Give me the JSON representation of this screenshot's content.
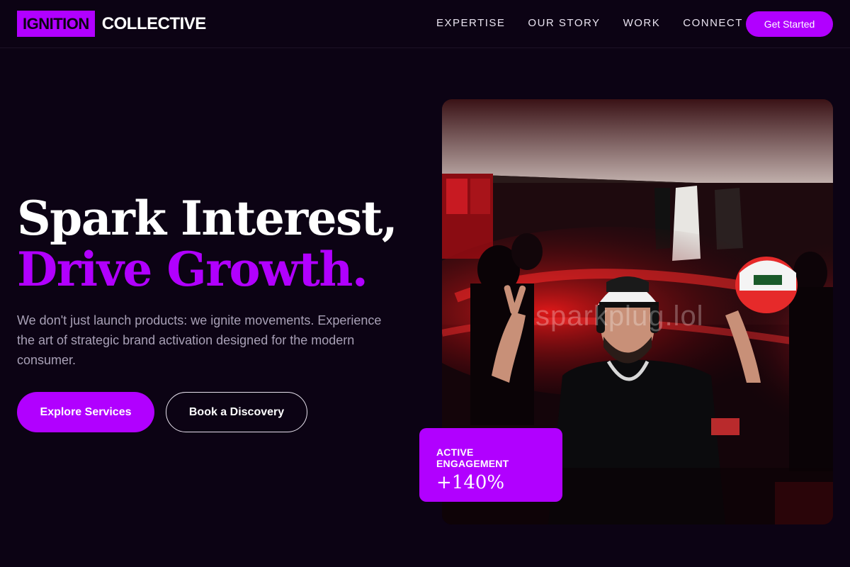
{
  "brand": {
    "logo_box": "IGNITION",
    "logo_text": "COLLECTIVE"
  },
  "nav": {
    "links": [
      "EXPERTISE",
      "OUR STORY",
      "WORK",
      "CONNECT"
    ],
    "cta": "Get Started"
  },
  "hero": {
    "headline_line1": "Spark Interest,",
    "headline_line2": "Drive Growth.",
    "subtext": "We don't just launch products: we ignite movements. Experience the art of strategic brand activation designed for the modern consumer.",
    "primary_button": "Explore Services",
    "secondary_button": "Book a Discovery"
  },
  "image": {
    "watermark": "sparkplug.lol"
  },
  "stat": {
    "label": "ACTIVE ENGAGEMENT",
    "value": "+140%"
  },
  "colors": {
    "background": "#0c0314",
    "accent": "#b100ff",
    "muted_text": "#a8a0b6"
  }
}
